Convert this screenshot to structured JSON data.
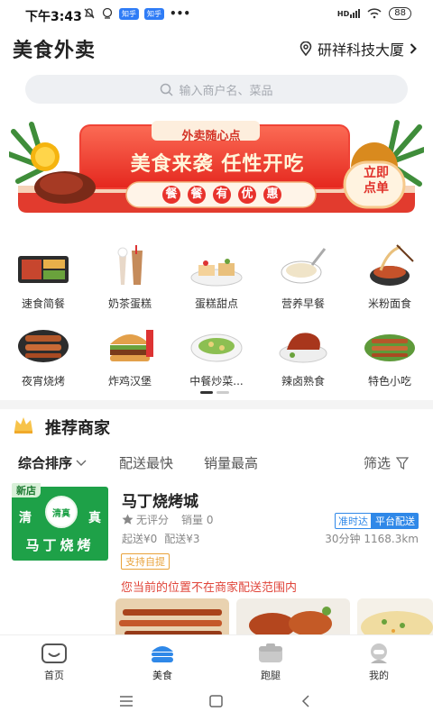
{
  "status_bar": {
    "time": "下午3:43",
    "chip1": "知乎",
    "chip2": "知乎",
    "battery": "88",
    "network": "HD"
  },
  "header": {
    "title": "美食外卖",
    "location": "研祥科技大厦"
  },
  "search": {
    "placeholder": "输入商户名、菜品"
  },
  "banner": {
    "top_text": "外卖随心点",
    "headline": "美食来袭 任性开吃",
    "subline_chars": [
      "餐",
      "餐",
      "有",
      "优",
      "惠"
    ],
    "cta_line1": "立即",
    "cta_line2": "点单"
  },
  "categories": [
    {
      "label": "速食简餐",
      "icon": "bento-icon"
    },
    {
      "label": "奶茶蛋糕",
      "icon": "milk-tea-icon"
    },
    {
      "label": "蛋糕甜点",
      "icon": "cake-icon"
    },
    {
      "label": "营养早餐",
      "icon": "breakfast-icon"
    },
    {
      "label": "米粉面食",
      "icon": "noodles-icon"
    },
    {
      "label": "夜宵烧烤",
      "icon": "skewer-icon"
    },
    {
      "label": "炸鸡汉堡",
      "icon": "burger-icon"
    },
    {
      "label": "中餐炒菜...",
      "icon": "stir-fry-icon"
    },
    {
      "label": "辣卤熟食",
      "icon": "braised-duck-icon"
    },
    {
      "label": "特色小吃",
      "icon": "snack-icon"
    }
  ],
  "recommend": {
    "title": "推荐商家",
    "sorts": {
      "comprehensive": "综合排序",
      "fastest": "配送最快",
      "top_sales": "销量最高",
      "filter": "筛选"
    }
  },
  "shop": {
    "badge": "新店",
    "logo_char_left": "清",
    "logo_char_right": "真",
    "logo_seal": "清真",
    "logo_name": "马丁烧烤",
    "name": "马丁烧烤城",
    "rating": "无评分",
    "sales": "销量 0",
    "tag_on_time": "准时达",
    "tag_platform": "平台配送",
    "min_order": "起送¥0",
    "delivery_fee": "配送¥3",
    "distance": "30分钟 1168.3km",
    "pickup": "支持自提",
    "warning": "您当前的位置不在商家配送范围内"
  },
  "tabbar": [
    {
      "label": "首页",
      "icon": "home-icon"
    },
    {
      "label": "美食",
      "icon": "food-icon",
      "active": true
    },
    {
      "label": "跑腿",
      "icon": "errand-icon"
    },
    {
      "label": "我的",
      "icon": "profile-icon"
    }
  ],
  "colors": {
    "brand_red": "#e8322c",
    "active_blue": "#2f88e8",
    "warning": "#e0453a",
    "green": "#1ea148"
  }
}
